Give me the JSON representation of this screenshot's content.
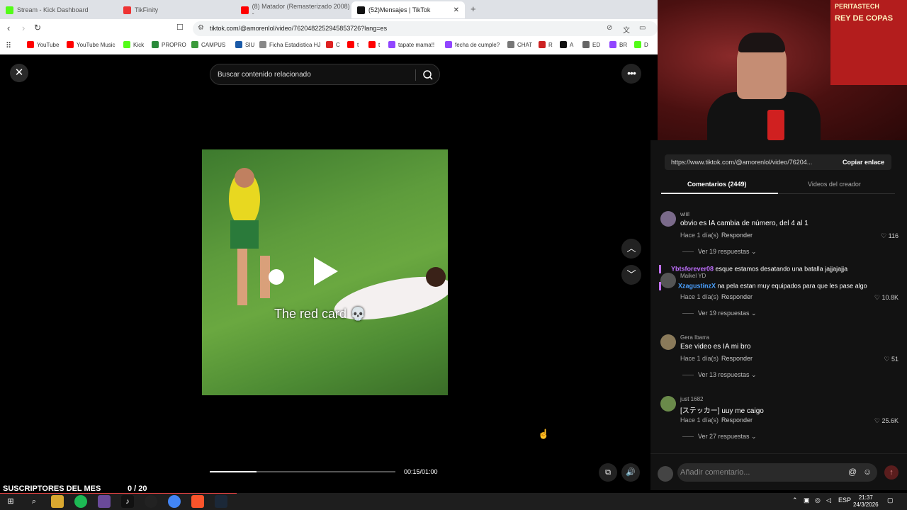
{
  "browser": {
    "tabs": [
      {
        "title": "Stream - Kick Dashboard",
        "color": "#53fc18"
      },
      {
        "title": "TikFinity",
        "color": "#e33"
      },
      {
        "title": "(8) Matador (Remasterizado 2008) - ",
        "color": "#f00"
      },
      {
        "title": "(52)Mensajes | TikTok",
        "color": "#111",
        "active": true
      }
    ],
    "new_tab": "+",
    "url": "tiktok.com/@amorenlol/video/7620482252945853726?lang=es",
    "bookmarks": [
      {
        "label": "YouTube",
        "color": "#f00"
      },
      {
        "label": "YouTube Music",
        "color": "#f00"
      },
      {
        "label": "Kick",
        "color": "#53fc18"
      },
      {
        "label": "PROPRO",
        "color": "#2a8a3a"
      },
      {
        "label": "CAMPUS",
        "color": "#3a9a3a"
      },
      {
        "label": "SIU",
        "color": "#1a5aa8"
      },
      {
        "label": "Ficha Estadistica HJ",
        "color": "#888"
      },
      {
        "label": "C",
        "color": "#d22"
      },
      {
        "label": "t",
        "color": "#f00"
      },
      {
        "label": "t",
        "color": "#f00"
      },
      {
        "label": "tapate mama!!",
        "color": "#9146ff"
      },
      {
        "label": "fecha de cumple?",
        "color": "#9146ff"
      },
      {
        "label": "CHAT",
        "color": "#777"
      },
      {
        "label": "R",
        "color": "#c22"
      },
      {
        "label": "A",
        "color": "#111"
      },
      {
        "label": "ED",
        "color": "#666"
      },
      {
        "label": "BR",
        "color": "#9146ff"
      },
      {
        "label": "D",
        "color": "#53fc18"
      }
    ]
  },
  "viewer": {
    "search_placeholder": "Buscar contenido relacionado",
    "video_caption": "The red card 💀",
    "time": "00:15/01:00",
    "progress": 0.25
  },
  "panel": {
    "link": "https://www.tiktok.com/@amorenlol/video/76204...",
    "copy_label": "Copiar enlace",
    "tab_comments": "Comentarios (2449)",
    "tab_creator": "Videos del creador",
    "comments": [
      {
        "user": "wiiil",
        "text": "obvio es IA cambia de número, del 4 al 1",
        "time": "Hace 1 día(s)",
        "reply": "Responder",
        "likes": "116",
        "more": "Ver 19 respuestas",
        "avatar": "#7a6a8a"
      },
      {
        "user": "Maikel YD",
        "text": "",
        "time": "Hace 1 día(s)",
        "reply": "Responder",
        "likes": "10.8K",
        "more": "Ver 19 respuestas",
        "avatar": "#555"
      },
      {
        "user": "Gera Ibarra",
        "text": "Ese video es IA mi bro",
        "time": "Hace 1 día(s)",
        "reply": "Responder",
        "likes": "51",
        "more": "Ver 13 respuestas",
        "avatar": "#8a7a5a"
      },
      {
        "user": "just 1682",
        "text": "[ステッカー] uuy me caigo",
        "time": "Hace 1 día(s)",
        "reply": "Responder",
        "likes": "25.6K",
        "more": "Ver 27 respuestas",
        "avatar": "#6a8a4a"
      }
    ],
    "chat_overlay": [
      {
        "name": "Ybtsforever08",
        "text": " esque estamos desatando una batalla jajjajajja",
        "color": "#c070ff"
      },
      {
        "name": "XzagustinzX",
        "text": " na pela estan muy equipados para que les pase algo",
        "color": "#4aa0ff"
      }
    ],
    "compose_placeholder": "Añadir comentario..."
  },
  "stream_overlay": {
    "subs_label": "SUSCRIPTORES DEL MES",
    "subs_count": "0  / 20",
    "poster_line1": "REY DE COPAS",
    "poster_line2": "PERITASTECH"
  },
  "taskbar": {
    "lang": "ESP",
    "time": "21:37",
    "date": "24/3/2026"
  },
  "icons": {
    "close": "close-icon",
    "search": "search-icon",
    "more": "more-icon",
    "up": "chevron-up-icon",
    "down": "chevron-down-icon",
    "volume": "volume-icon",
    "heart": "heart-icon"
  }
}
